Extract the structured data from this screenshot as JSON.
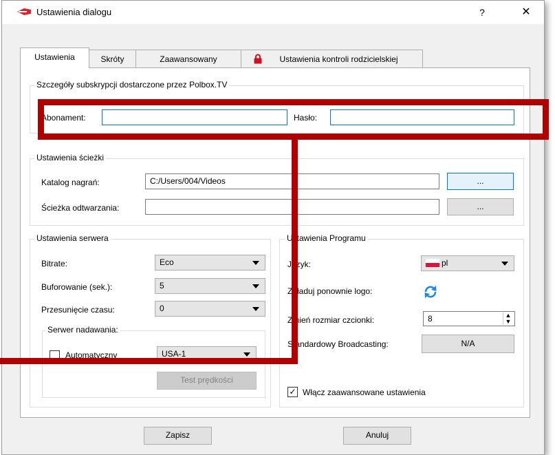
{
  "window": {
    "title": "Ustawienia dialogu",
    "help": "?",
    "close": "✕"
  },
  "tabs": [
    "Ustawienia",
    "Skróty",
    "Zaawansowany",
    "Ustawienia kontroli rodzicielskiej"
  ],
  "subscription": {
    "group_title": "Szczegóły subskrypcji dostarczone przez Polbox.TV",
    "account_label": "Abonament:",
    "account_value": "",
    "password_label": "Hasło:",
    "password_value": ""
  },
  "paths": {
    "group_title": "Ustawienia ścieżki",
    "recordings_label": "Katalog nagrań:",
    "recordings_value": "C:/Users/004/Videos",
    "playback_label": "Ścieżka odtwarzania:",
    "playback_value": "",
    "browse_label": "..."
  },
  "server": {
    "group_title": "Ustawienia serwera",
    "bitrate_label": "Bitrate:",
    "bitrate_value": "Eco",
    "buffer_label": "Buforowanie (sek.):",
    "buffer_value": "5",
    "timeshift_label": "Przesunięcie czasu:",
    "timeshift_value": "0",
    "broadcast_group": "Serwer nadawania:",
    "auto_label": "Automatyczny",
    "server_value": "USA-1",
    "speedtest_label": "Test prędkości"
  },
  "program": {
    "group_title": "Ustawienia Programu",
    "language_label": "Język:",
    "language_value": "pl",
    "reload_logo_label": "Załaduj ponownie logo:",
    "font_size_label": "Zmień rozmiar czcionki:",
    "font_size_value": "8",
    "broadcasting_label": "Standardowy Broadcasting:",
    "broadcasting_value": "N/A",
    "advanced_label": "Włącz zaawansowane ustawienia",
    "advanced_checked": true
  },
  "footer": {
    "save": "Zapisz",
    "cancel": "Anuluj"
  },
  "colors": {
    "annotation_red": "#b00000",
    "focus_blue": "#0078d7",
    "refresh_blue": "#1e88e5"
  }
}
